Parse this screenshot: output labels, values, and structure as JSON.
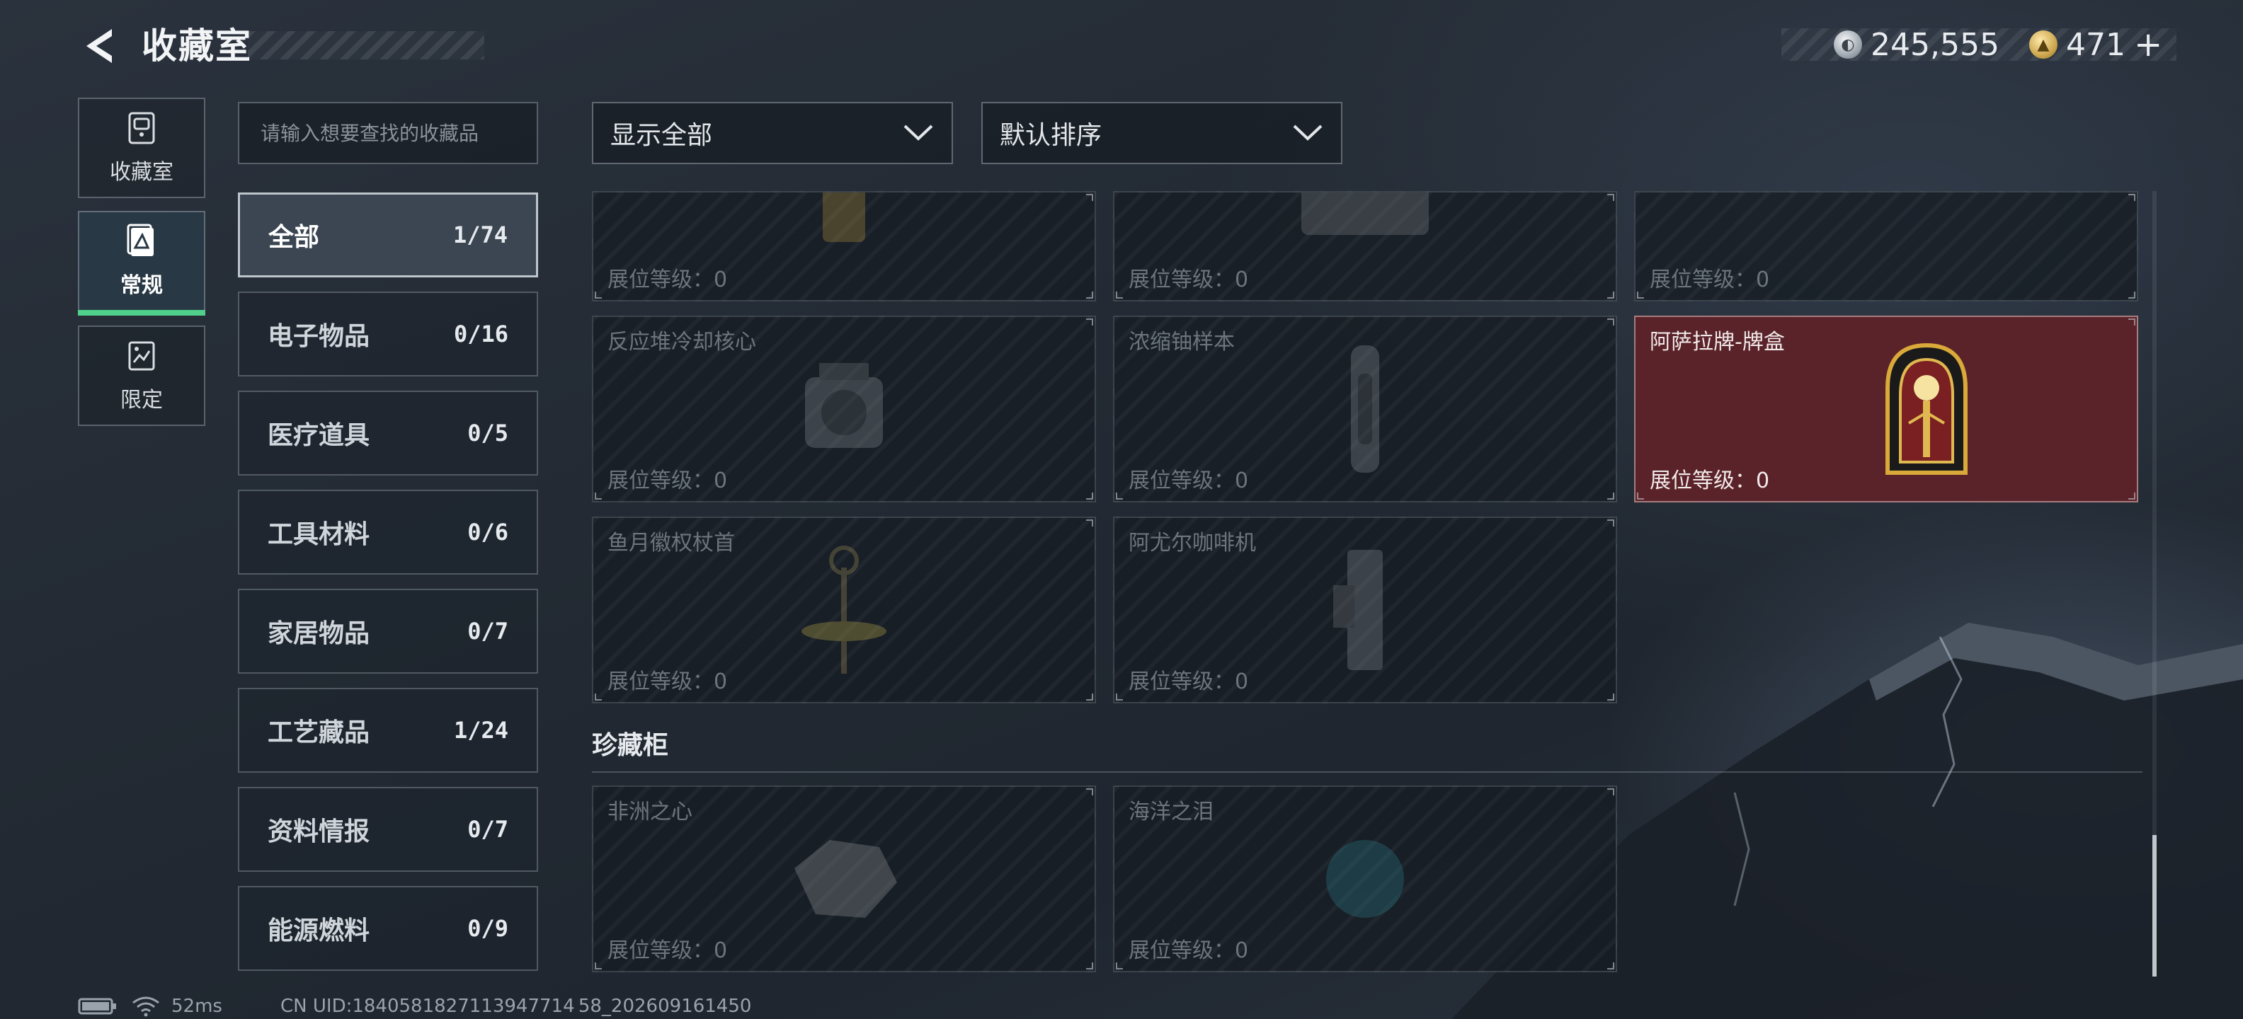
{
  "header": {
    "title": "收藏室",
    "currency_silver": "245,555",
    "currency_gold": "471",
    "currency_gold_plus": "+"
  },
  "rail": {
    "items": [
      {
        "label": "收藏室",
        "icon": "collection-room-icon"
      },
      {
        "label": "常规",
        "icon": "regular-card-icon",
        "active": true
      },
      {
        "label": "限定",
        "icon": "limited-card-icon"
      }
    ]
  },
  "search": {
    "placeholder": "请输入想要查找的收藏品"
  },
  "categories": [
    {
      "name": "全部",
      "count": "1/74",
      "active": true
    },
    {
      "name": "电子物品",
      "count": "0/16"
    },
    {
      "name": "医疗道具",
      "count": "0/5"
    },
    {
      "name": "工具材料",
      "count": "0/6"
    },
    {
      "name": "家居物品",
      "count": "0/7"
    },
    {
      "name": "工艺藏品",
      "count": "1/24"
    },
    {
      "name": "资料情报",
      "count": "0/7"
    },
    {
      "name": "能源燃料",
      "count": "0/9"
    }
  ],
  "filters": {
    "display": "显示全部",
    "sort": "默认排序"
  },
  "grid": {
    "level_label": "展位等级：0",
    "row0": [
      {
        "name": ""
      },
      {
        "name": ""
      },
      {
        "name": ""
      }
    ],
    "row1": [
      {
        "name": "反应堆冷却核心"
      },
      {
        "name": "浓缩铀样本"
      },
      {
        "name": "阿萨拉牌-牌盒",
        "owned": true
      }
    ],
    "row2": [
      {
        "name": "鱼月徽权杖首"
      },
      {
        "name": "阿尤尔咖啡机"
      }
    ]
  },
  "cabinet": {
    "title": "珍藏柜",
    "items": [
      {
        "name": "非洲之心"
      },
      {
        "name": "海洋之泪"
      }
    ]
  },
  "status": {
    "ping": "52ms",
    "uid": "CN UID:1840581827113947714 58_202609161450"
  }
}
